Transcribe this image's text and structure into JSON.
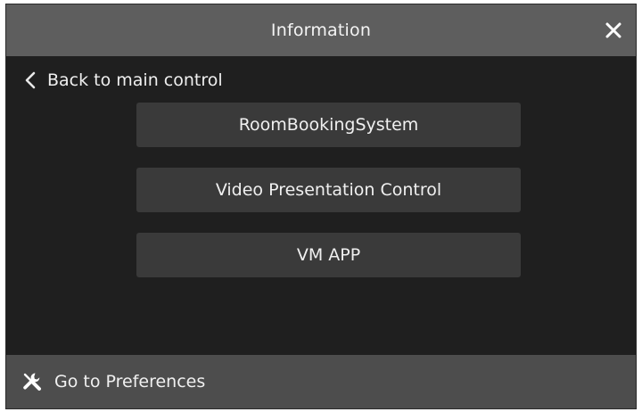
{
  "window": {
    "title": "Information",
    "close_icon": "close-icon"
  },
  "nav": {
    "back_label": "Back to main control",
    "back_icon": "chevron-left-icon"
  },
  "menu": {
    "items": [
      {
        "label": "RoomBookingSystem"
      },
      {
        "label": "Video Presentation Control"
      },
      {
        "label": "VM APP"
      }
    ]
  },
  "footer": {
    "label": "Go to Preferences",
    "icon": "tools-icon"
  },
  "colors": {
    "background": "#1f1f1f",
    "titlebar": "#5e5e5e",
    "button": "#3a3a3a",
    "footer": "#4d4d4d",
    "text": "#f0f0f0"
  }
}
